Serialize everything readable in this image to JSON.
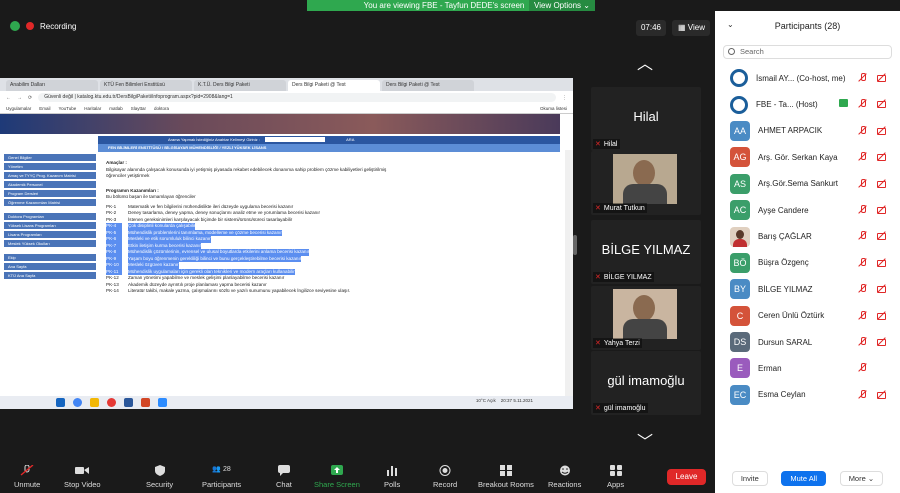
{
  "banner": {
    "message": "You are viewing FBE - Tayfun DEDE's screen",
    "view_options": "View Options ⌄"
  },
  "recording": {
    "label": "Recording"
  },
  "clock": "07:46",
  "view_button": "View",
  "browser": {
    "tabs": [
      "Anabilim Dalları",
      "KTÜ Fen Bilimleri Enstitüsü",
      "K.T.Ü. Ders Bilgi Paketi",
      "Ders Bilgi Paketi @ Test",
      "Ders Bilgi Paketi @ Test"
    ],
    "address": "katalog.ktu.edu.tr/DersBilgiPaketi/infoprogram.aspx?pid=2908&lang=1",
    "secure_label": "Güvenli değil",
    "bookmarks": [
      "Uygulamalar",
      "Email",
      "YouTube",
      "Haritalar",
      "matlab",
      "Slayttar",
      "doktora"
    ],
    "reading_list": "Okuma listesi",
    "search_strip": "Arama Yapmak İstediğiniz Anahtar Kelimeyi Giriniz :",
    "search_button": "ARA",
    "header": "FEN BİLİMLERİ ENSTİTÜSÜ / BİLGİSAYAR MÜHENDİSLİĞİ / YEZLİ YÜKSEK LİSANS",
    "nav": [
      "Genel Bilgiler",
      "Yönetim",
      "Amaç ve TYYÇ Prog. Kazanım Matrisi",
      "Akademik Personel",
      "Program Dersleri",
      "Öğrenme Kazanımları Matrisi",
      "Doktora Programları",
      "Yüksek Lisans Programları",
      "Lisans Programları",
      "Meslek Yüksek Okulları",
      "Ekip",
      "Ana Sayfa",
      "KTÜ Ana Sayfa"
    ],
    "content": {
      "aims_heading": "Amaçlar :",
      "aims_text": "Bilgisayar alanında çalışacak konusunda iyi yetişmiş piyasada rekabet edebilecek donanıma sahip problem çözme kabiliyetleri geliştirilmiş öğrenciler yetiştirmek",
      "outcomes_heading": "Programın Kazanımları :",
      "outcomes_intro": "Bu bölümü başarı ile tamamlayan öğrenciler",
      "items": [
        {
          "code": "PK-1",
          "text": "Matematik ve fen bilgilerini mühendislikte ileri düzeyde uygulama becerisi kazanır",
          "sel": false
        },
        {
          "code": "PK-2",
          "text": "Deney tasarlama, deney yapma, deney sonuçlarını analiz etme ve yorumlama becerisi kazanır",
          "sel": false
        },
        {
          "code": "PK-3",
          "text": "İstenen gereksinimleri karşılayacak biçimde bir sistemi/ürünü/süreci tasarlayabilir",
          "sel": false
        },
        {
          "code": "PK-4",
          "text": "Çok disiplinli konularda çalışabilir",
          "sel": true
        },
        {
          "code": "PK-5",
          "text": "Mühendislik problemlerini tanımlama, modelleme ve çözme becerisi kazanır",
          "sel": true
        },
        {
          "code": "PK-6",
          "text": "Mesleki ve etik sorumluluk bilinci kazanır",
          "sel": true
        },
        {
          "code": "PK-7",
          "text": "Etkin iletişim kurma becerisi kazanır",
          "sel": true
        },
        {
          "code": "PK-8",
          "text": "Mühendislik çözümlerinin, evrensel ve ulusal boyutlarda etkilerini anlama becerisi kazanır",
          "sel": true
        },
        {
          "code": "PK-9",
          "text": "Yaşam boyu öğrenmenin gerekliliği bilinci ve bunu gerçekleştirebilme becerisi kazanır",
          "sel": true
        },
        {
          "code": "PK-10",
          "text": "Mesleki özgüven kazanır",
          "sel": true
        },
        {
          "code": "PK-11",
          "text": "Mühendislik uygulamaları için gerekli olan teknikleri ve modern araçları kullanabilir",
          "sel": true
        },
        {
          "code": "PK-12",
          "text": "Zaman yönetimi yapabilme ve meslek gelişimi planlayabilme becerisi kazanır",
          "sel": false
        },
        {
          "code": "PK-13",
          "text": "Akademik düzeyde ayrıntılı proje planlaması yapma becerisi kazanır",
          "sel": false
        },
        {
          "code": "PK-14",
          "text": "Literatür takibi, makale yazma, çalışmalarını sözlü ve yazılı sunumunu yapabilecek İngilizce seviyesine ulaşır.",
          "sel": false
        }
      ]
    },
    "taskbar": {
      "weather": "10°C",
      "weather_label": "Açık",
      "time": "20:37",
      "date": "5.11.2021"
    }
  },
  "tiles": [
    {
      "name": "Hilal",
      "label": "Hilal",
      "big": "Hilal",
      "has_face": false
    },
    {
      "name": "Murat Tutkun",
      "label": "Murat Tutkun",
      "big": "",
      "has_face": true,
      "face_color": "#b8a890"
    },
    {
      "name": "BİLGE YILMAZ",
      "label": "BİLGE YILMAZ",
      "big": "BİLGE  YILMAZ",
      "has_face": false
    },
    {
      "name": "Yahya Terzi",
      "label": "Yahya Terzi",
      "big": "",
      "has_face": true,
      "face_color": "#c9b5a0"
    },
    {
      "name": "gül imamoğlu",
      "label": "gül imamoğlu",
      "big": "gül imamoğlu",
      "has_face": false
    }
  ],
  "participants": {
    "title": "Participants (28)",
    "search_placeholder": "Search",
    "list": [
      {
        "initials": "",
        "name": "İsmail AY... (Co-host, me)",
        "color": "#1b5e9a",
        "logo": true,
        "mic_on": false,
        "cam_on": false
      },
      {
        "initials": "",
        "name": "FBE - Ta...  (Host)",
        "color": "#1b5e9a",
        "logo": true,
        "mic_on": false,
        "cam_on": false,
        "sharing": true
      },
      {
        "initials": "AA",
        "name": "AHMET ARPACIK",
        "color": "#4a8bc4",
        "mic_on": false,
        "cam_on": false
      },
      {
        "initials": "AG",
        "name": "Arş. Gör. Serkan Kaya",
        "color": "#d4533a",
        "mic_on": false,
        "cam_on": false
      },
      {
        "initials": "AS",
        "name": "Arş.Gör.Sema Sankurt",
        "color": "#3b9e6a",
        "mic_on": false,
        "cam_on": false
      },
      {
        "initials": "AC",
        "name": "Ayşe Candere",
        "color": "#3b9e6a",
        "mic_on": false,
        "cam_on": false
      },
      {
        "initials": "",
        "name": "Barış ÇAĞLAR",
        "color": "#ffffff",
        "photo": true,
        "mic_on": false,
        "cam_on": false
      },
      {
        "initials": "BÖ",
        "name": "Büşra Özgenç",
        "color": "#3b9e6a",
        "mic_on": false,
        "cam_on": false
      },
      {
        "initials": "BY",
        "name": "BİLGE  YILMAZ",
        "color": "#4a8bc4",
        "mic_on": false,
        "cam_on": false
      },
      {
        "initials": "C",
        "name": "Ceren Ünlü Öztürk",
        "color": "#d4533a",
        "mic_on": false,
        "cam_on": false
      },
      {
        "initials": "DS",
        "name": "Dursun SARAL",
        "color": "#5a6a7a",
        "mic_on": false,
        "cam_on": false
      },
      {
        "initials": "E",
        "name": "Erman",
        "color": "#9a5bbd",
        "mic_on": false,
        "cam_hidden": true
      },
      {
        "initials": "EC",
        "name": "Esma Ceylan",
        "color": "#4a8bc4",
        "mic_on": false,
        "cam_on": false
      }
    ],
    "invite": "Invite",
    "mute_all": "Mute All",
    "more": "More ⌄"
  },
  "toolbar": {
    "unmute": "Unmute",
    "stop_video": "Stop Video",
    "security": "Security",
    "participants": "Participants",
    "participants_count": "28",
    "chat": "Chat",
    "share_screen": "Share Screen",
    "polls": "Polls",
    "record": "Record",
    "breakout": "Breakout Rooms",
    "reactions": "Reactions",
    "apps": "Apps",
    "leave": "Leave"
  }
}
